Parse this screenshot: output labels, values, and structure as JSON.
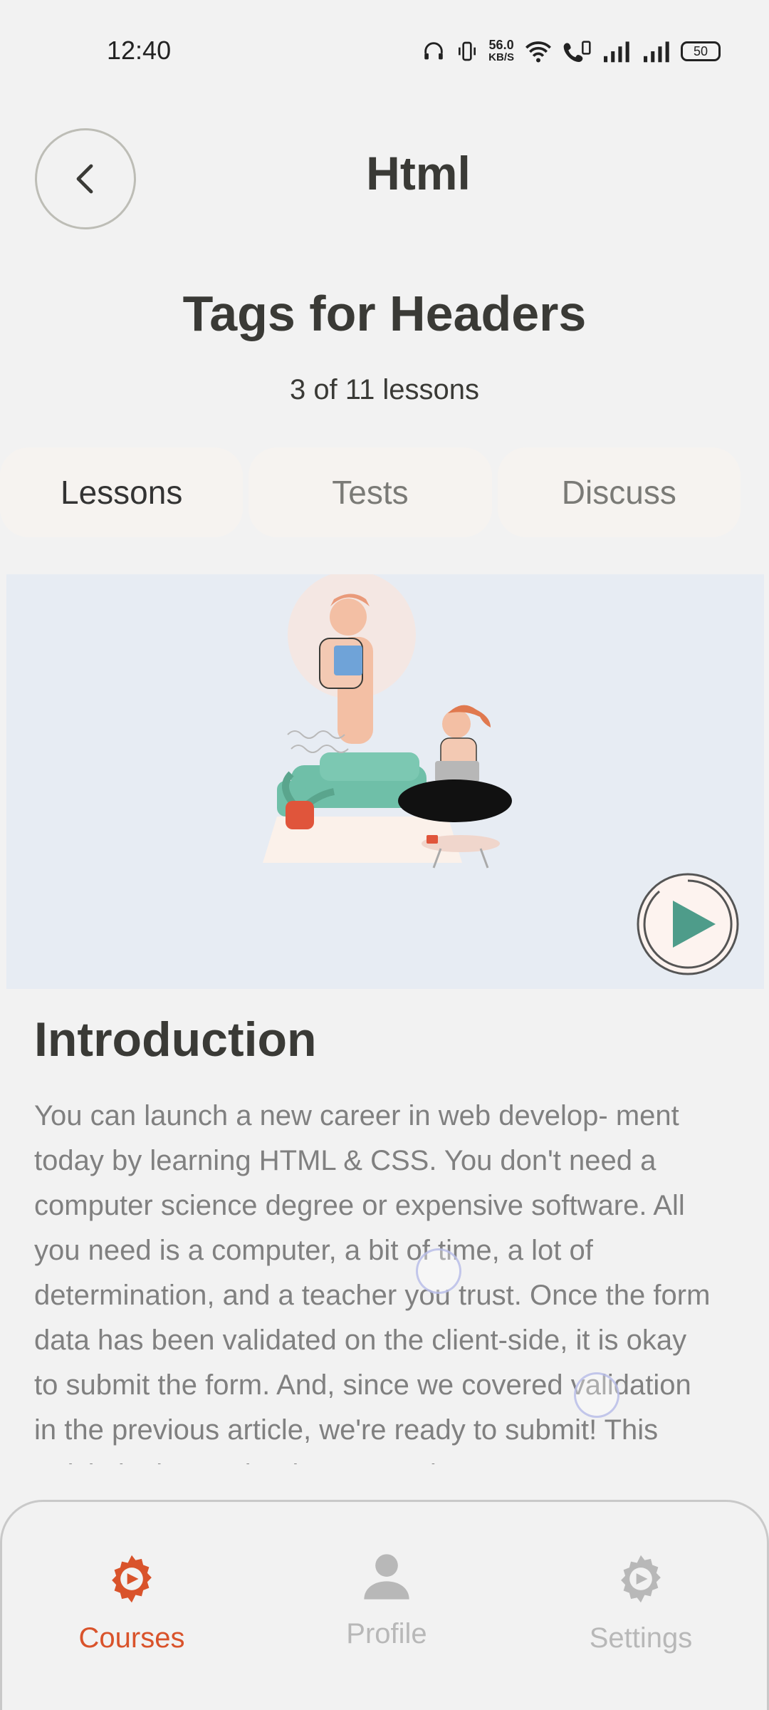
{
  "status_bar": {
    "time": "12:40",
    "net_speed_value": "56.0",
    "net_speed_unit": "KB/S",
    "battery": "50"
  },
  "header": {
    "back_icon": "chevron-left-icon",
    "course_title": "Html"
  },
  "lesson": {
    "title": "Tags for Headers",
    "count": "3 of 11 lessons"
  },
  "tabs": [
    {
      "label": "Lessons",
      "active": true
    },
    {
      "label": "Tests",
      "active": false
    },
    {
      "label": "Discuss",
      "active": false
    }
  ],
  "media": {
    "play_icon": "play-icon"
  },
  "content": {
    "heading": "Introduction",
    "body": "You can launch a new career in web develop- ment today by learning HTML & CSS. You don't need a computer science degree or expensive software. All you need is a computer, a bit of time, a lot of determination, and a teacher you trust. Once the form data has been validated on the client-side, it is okay to submit the form. And, since we covered validation in the previous article, we're ready to submit! This article looks at what happens when"
  },
  "bottom_nav": {
    "items": [
      {
        "label": "Courses",
        "icon": "courses-gear-icon",
        "active": true
      },
      {
        "label": "Profile",
        "icon": "profile-icon",
        "active": false
      },
      {
        "label": "Settings",
        "icon": "settings-gear-icon",
        "active": false
      }
    ]
  },
  "colors": {
    "accent": "#d9532b",
    "background": "#f2f2f2",
    "media_bg": "#e7ecf3",
    "tab_bg": "#f6f3f0"
  }
}
